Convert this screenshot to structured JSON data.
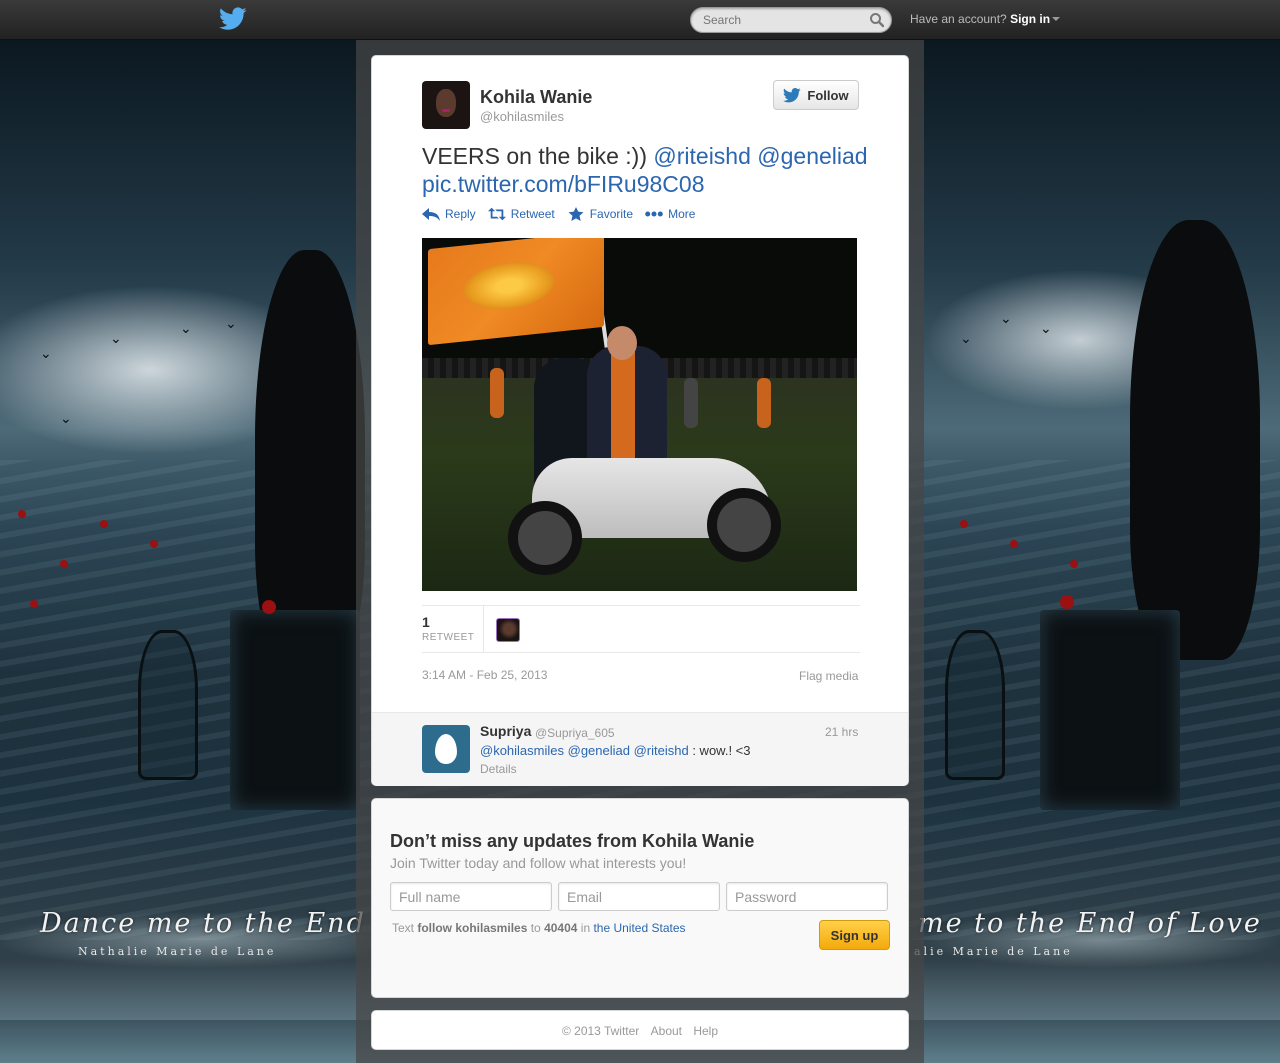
{
  "topbar": {
    "search_placeholder": "Search",
    "account_prompt": "Have an account?",
    "signin_label": "Sign in"
  },
  "tweet": {
    "author_name": "Kohila Wanie",
    "author_handle": "@kohilasmiles",
    "follow_label": "Follow",
    "text_plain": "VEERS on the bike :)) ",
    "mention_1": "@riteishd",
    "mention_2": "@geneliad",
    "media_link": "pic.twitter.com/bFIRu98C08",
    "actions": {
      "reply": "Reply",
      "retweet": "Retweet",
      "favorite": "Favorite",
      "more": "More"
    },
    "retweet_count": "1",
    "retweet_label": "RETWEET",
    "timestamp": "3:14 AM - Feb 25, 2013",
    "flag_media": "Flag media"
  },
  "reply": {
    "name": "Supriya",
    "handle": "@Supriya_605",
    "time": "21 hrs",
    "mention_1": "@kohilasmiles",
    "mention_2": "@geneliad",
    "mention_3": "@riteishd",
    "text": " : wow.! <3",
    "details": "Details"
  },
  "signup": {
    "title": "Don’t miss any updates from Kohila Wanie",
    "subtitle": "Join Twitter today and follow what interests you!",
    "fullname_placeholder": "Full name",
    "email_placeholder": "Email",
    "password_placeholder": "Password",
    "sms_prefix": "Text ",
    "sms_command": "follow kohilasmiles",
    "sms_to": " to ",
    "sms_number": "40404",
    "sms_in": " in ",
    "sms_country": "the United States",
    "button_label": "Sign up"
  },
  "footer": {
    "copyright": "© 2013 Twitter",
    "about": "About",
    "help": "Help"
  },
  "background": {
    "script_text": "Dance me to the End of Love",
    "script_subtext": "Nathalie Marie de Lane",
    "script_text_right": "me to the End of Love",
    "script_subtext_right": "alie Marie de Lane"
  },
  "colors": {
    "link": "#2b66b0",
    "topbar": "#2b2b2b",
    "signup_button": "#f4a90a",
    "twitter_blue": "#55acee"
  },
  "icons": [
    "twitter-bird-icon",
    "search-icon",
    "reply-icon",
    "retweet-icon",
    "star-icon",
    "more-icon",
    "egg-icon"
  ]
}
